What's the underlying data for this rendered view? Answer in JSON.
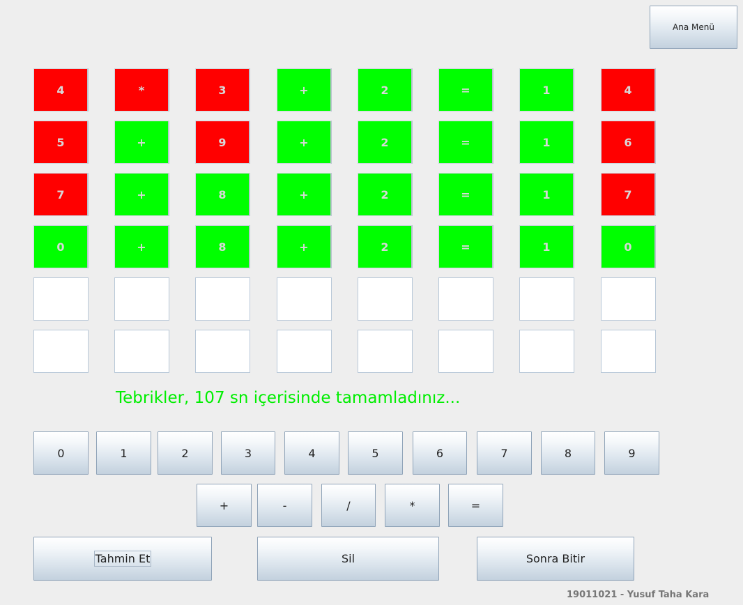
{
  "header": {
    "main_menu_label": "Ana Menü"
  },
  "colors": {
    "correct": "#00ff00",
    "wrong": "#ff0000",
    "empty": "#ffffff",
    "message": "#00ee00",
    "cell_text": "#d8d8d8"
  },
  "board": {
    "rows": [
      {
        "cells": [
          {
            "value": "4",
            "state": "wrong"
          },
          {
            "value": "*",
            "state": "wrong"
          },
          {
            "value": "3",
            "state": "wrong"
          },
          {
            "value": "+",
            "state": "correct"
          },
          {
            "value": "2",
            "state": "correct"
          },
          {
            "value": "=",
            "state": "correct"
          },
          {
            "value": "1",
            "state": "correct"
          },
          {
            "value": "4",
            "state": "wrong"
          }
        ]
      },
      {
        "cells": [
          {
            "value": "5",
            "state": "wrong"
          },
          {
            "value": "+",
            "state": "correct"
          },
          {
            "value": "9",
            "state": "wrong"
          },
          {
            "value": "+",
            "state": "correct"
          },
          {
            "value": "2",
            "state": "correct"
          },
          {
            "value": "=",
            "state": "correct"
          },
          {
            "value": "1",
            "state": "correct"
          },
          {
            "value": "6",
            "state": "wrong"
          }
        ]
      },
      {
        "cells": [
          {
            "value": "7",
            "state": "wrong"
          },
          {
            "value": "+",
            "state": "correct"
          },
          {
            "value": "8",
            "state": "correct"
          },
          {
            "value": "+",
            "state": "correct"
          },
          {
            "value": "2",
            "state": "correct"
          },
          {
            "value": "=",
            "state": "correct"
          },
          {
            "value": "1",
            "state": "correct"
          },
          {
            "value": "7",
            "state": "wrong"
          }
        ]
      },
      {
        "cells": [
          {
            "value": "0",
            "state": "correct"
          },
          {
            "value": "+",
            "state": "correct"
          },
          {
            "value": "8",
            "state": "correct"
          },
          {
            "value": "+",
            "state": "correct"
          },
          {
            "value": "2",
            "state": "correct"
          },
          {
            "value": "=",
            "state": "correct"
          },
          {
            "value": "1",
            "state": "correct"
          },
          {
            "value": "0",
            "state": "correct"
          }
        ]
      },
      {
        "cells": [
          {
            "value": "",
            "state": "empty"
          },
          {
            "value": "",
            "state": "empty"
          },
          {
            "value": "",
            "state": "empty"
          },
          {
            "value": "",
            "state": "empty"
          },
          {
            "value": "",
            "state": "empty"
          },
          {
            "value": "",
            "state": "empty"
          },
          {
            "value": "",
            "state": "empty"
          },
          {
            "value": "",
            "state": "empty"
          }
        ]
      },
      {
        "cells": [
          {
            "value": "",
            "state": "empty"
          },
          {
            "value": "",
            "state": "empty"
          },
          {
            "value": "",
            "state": "empty"
          },
          {
            "value": "",
            "state": "empty"
          },
          {
            "value": "",
            "state": "empty"
          },
          {
            "value": "",
            "state": "empty"
          },
          {
            "value": "",
            "state": "empty"
          },
          {
            "value": "",
            "state": "empty"
          }
        ]
      }
    ]
  },
  "message": "Tebrikler, 107 sn içerisinde tamamladınız...",
  "keypad": {
    "digits": [
      "0",
      "1",
      "2",
      "3",
      "4",
      "5",
      "6",
      "7",
      "8",
      "9"
    ],
    "operators": [
      "+",
      "-",
      "/",
      "*",
      "="
    ]
  },
  "actions": {
    "guess_label": "Tahmin Et",
    "delete_label": "Sil",
    "finish_later_label": "Sonra Bitir"
  },
  "footer": {
    "author": "19011021 - Yusuf Taha Kara"
  }
}
